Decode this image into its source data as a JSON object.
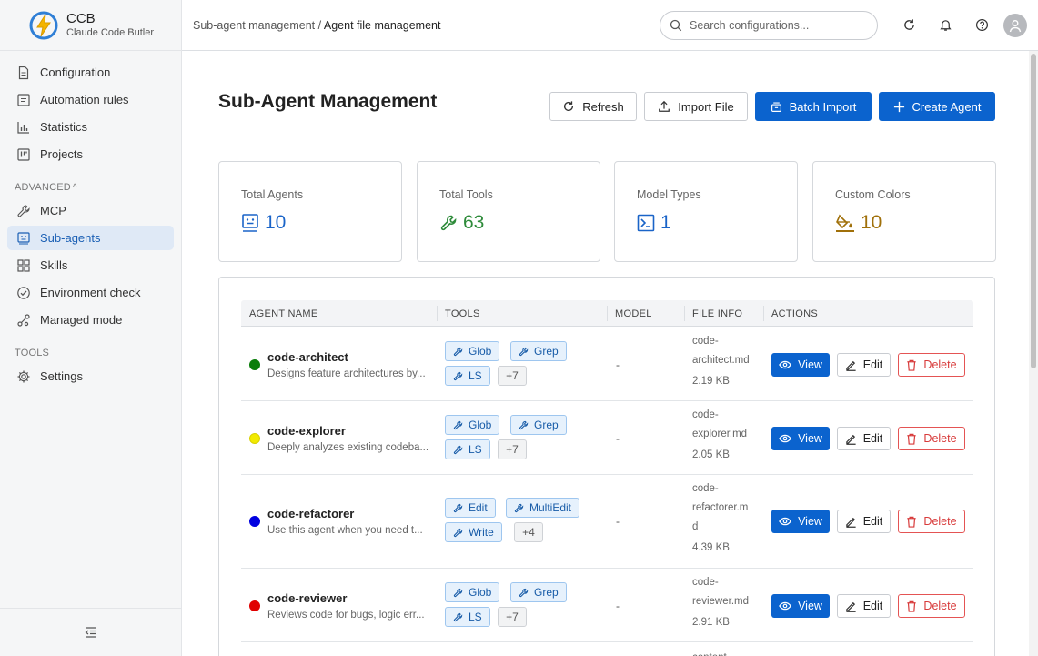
{
  "app": {
    "name": "CCB",
    "subtitle": "Claude Code Butler"
  },
  "sidebar": {
    "items_top": [
      {
        "label": "Configuration",
        "icon": "file-icon"
      },
      {
        "label": "Automation rules",
        "icon": "rules-icon"
      },
      {
        "label": "Statistics",
        "icon": "chart-icon"
      },
      {
        "label": "Projects",
        "icon": "project-icon"
      }
    ],
    "advanced_label": "ADVANCED",
    "items_advanced": [
      {
        "label": "MCP",
        "icon": "wrench-icon"
      },
      {
        "label": "Sub-agents",
        "icon": "agent-icon",
        "active": true
      },
      {
        "label": "Skills",
        "icon": "grid-icon"
      },
      {
        "label": "Environment check",
        "icon": "check-circle-icon"
      },
      {
        "label": "Managed mode",
        "icon": "nodes-icon"
      }
    ],
    "tools_label": "TOOLS",
    "items_tools": [
      {
        "label": "Settings",
        "icon": "gear-icon"
      }
    ]
  },
  "header": {
    "breadcrumb_parent": "Sub-agent management",
    "breadcrumb_sep": "/",
    "breadcrumb_current": "Agent file management",
    "search_placeholder": "Search configurations..."
  },
  "page": {
    "title": "Sub-Agent Management",
    "buttons": {
      "refresh": "Refresh",
      "import_file": "Import File",
      "batch_import": "Batch Import",
      "create_agent": "Create Agent"
    }
  },
  "stats": [
    {
      "label": "Total Agents",
      "value": "10",
      "color": "#1a64c8",
      "icon": "agent-icon"
    },
    {
      "label": "Total Tools",
      "value": "63",
      "color": "#2e8b3a",
      "icon": "wrench-icon"
    },
    {
      "label": "Model Types",
      "value": "1",
      "color": "#1a64c8",
      "icon": "terminal-icon"
    },
    {
      "label": "Custom Colors",
      "value": "10",
      "color": "#a0700a",
      "icon": "paint-bucket-icon"
    }
  ],
  "table": {
    "columns": [
      "AGENT NAME",
      "TOOLS",
      "MODEL",
      "FILE INFO",
      "ACTIONS"
    ],
    "actions": {
      "view": "View",
      "edit": "Edit",
      "delete": "Delete"
    },
    "rows": [
      {
        "name": "code-architect",
        "description": "Designs feature architectures by...",
        "color": "#0a7d0a",
        "tools": [
          "Glob",
          "Grep",
          "LS"
        ],
        "more": "+7",
        "model": "-",
        "file_lines": [
          "code-",
          "architect.md"
        ],
        "size": "2.19 KB"
      },
      {
        "name": "code-explorer",
        "description": "Deeply analyzes existing codeba...",
        "color": "#f2ea00",
        "tools": [
          "Glob",
          "Grep",
          "LS"
        ],
        "more": "+7",
        "model": "-",
        "file_lines": [
          "code-",
          "explorer.md"
        ],
        "size": "2.05 KB"
      },
      {
        "name": "code-refactorer",
        "description": "Use this agent when you need t...",
        "color": "#0000e0",
        "tools": [
          "Edit",
          "MultiEdit",
          "Write"
        ],
        "more": "+4",
        "model": "-",
        "file_lines": [
          "code-",
          "refactorer.m",
          "d"
        ],
        "size": "4.39 KB"
      },
      {
        "name": "code-reviewer",
        "description": "Reviews code for bugs, logic err...",
        "color": "#e00000",
        "tools": [
          "Glob",
          "Grep",
          "LS"
        ],
        "more": "+7",
        "model": "-",
        "file_lines": [
          "code-",
          "reviewer.md"
        ],
        "size": "2.91 KB"
      }
    ],
    "partial_next_row_file": "content-"
  }
}
